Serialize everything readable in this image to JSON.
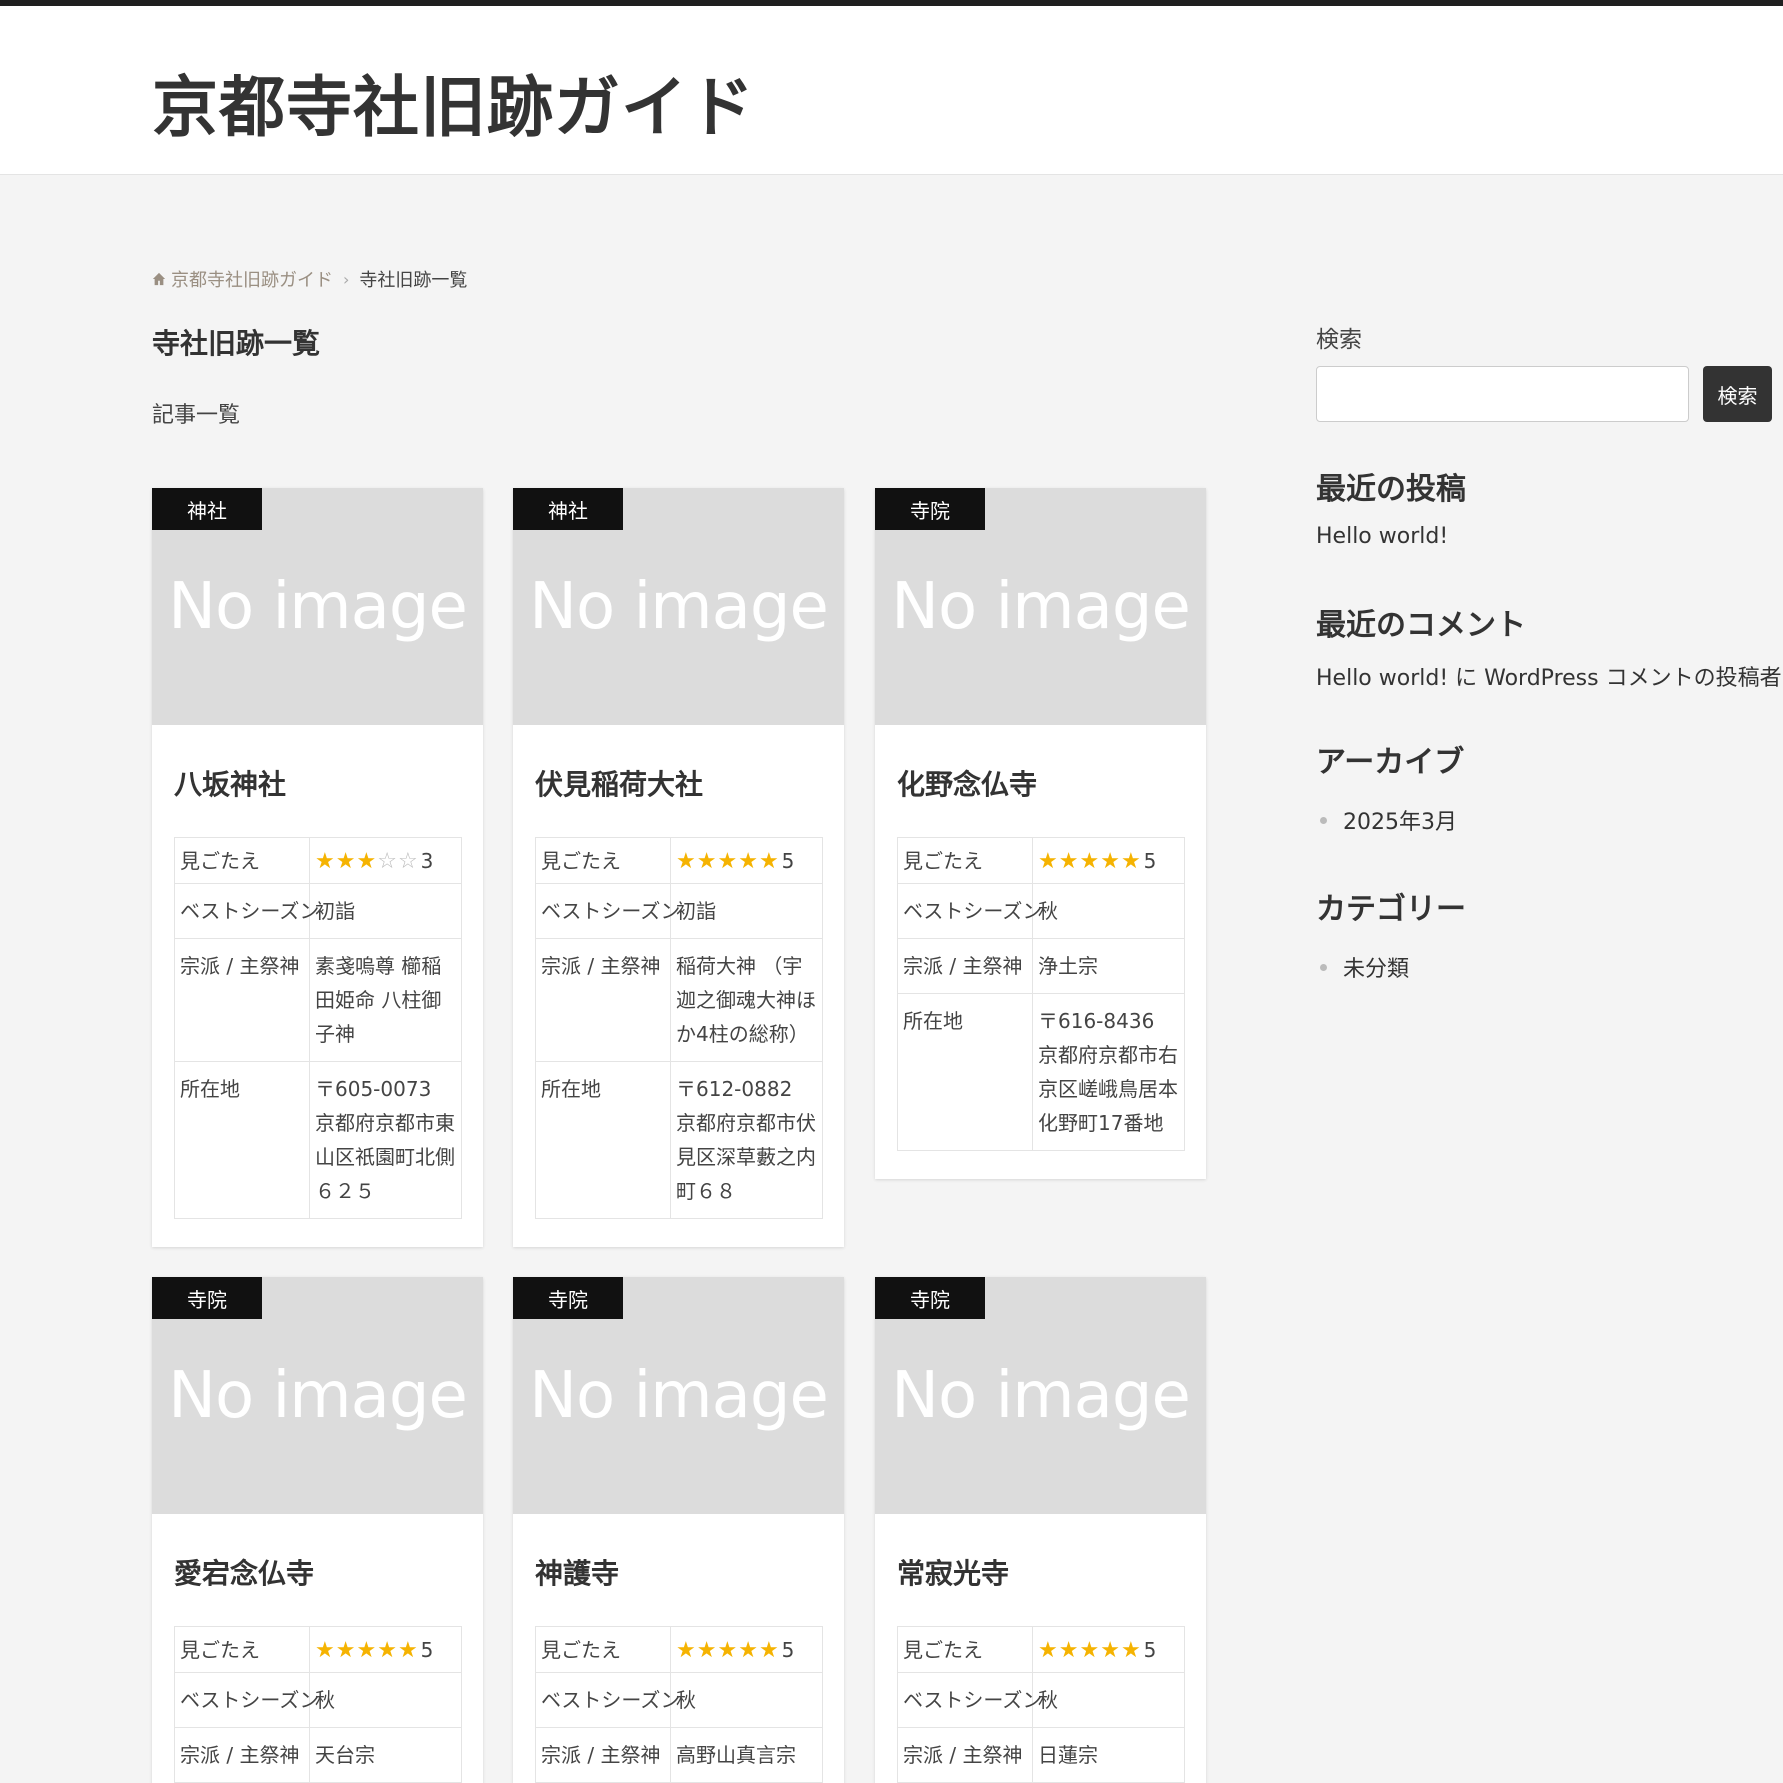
{
  "site": {
    "title": "京都寺社旧跡ガイド"
  },
  "breadcrumb": {
    "home": "京都寺社旧跡ガイド",
    "separator": "›",
    "current": "寺社旧跡一覧"
  },
  "page": {
    "title": "寺社旧跡一覧",
    "subtitle": "記事一覧"
  },
  "labels": {
    "no_image": "No image",
    "rating": "見ごたえ",
    "season": "ベストシーズン",
    "sect": "宗派 / 主祭神",
    "address": "所在地"
  },
  "cards": [
    {
      "category": "神社",
      "title": "八坂神社",
      "rating": 3,
      "rating_label": "3",
      "season": "初詣",
      "sect": "素戔嗚尊 櫛稲田姫命 八柱御子神",
      "address": "〒605-0073 京都府京都市東山区祇園町北側６２５"
    },
    {
      "category": "神社",
      "title": "伏見稲荷大社",
      "rating": 5,
      "rating_label": "5",
      "season": "初詣",
      "sect": "稲荷大神 （宇迦之御魂大神ほか4柱の総称）",
      "address": "〒612-0882 京都府京都市伏見区深草藪之内町６８"
    },
    {
      "category": "寺院",
      "title": "化野念仏寺",
      "rating": 5,
      "rating_label": "5",
      "season": "秋",
      "sect": "浄土宗",
      "address": "〒616-8436 京都府京都市右京区嵯峨鳥居本化野町17番地"
    },
    {
      "category": "寺院",
      "title": "愛宕念仏寺",
      "rating": 5,
      "rating_label": "5",
      "season": "秋",
      "sect": "天台宗",
      "address": ""
    },
    {
      "category": "寺院",
      "title": "神護寺",
      "rating": 5,
      "rating_label": "5",
      "season": "秋",
      "sect": "高野山真言宗",
      "address": ""
    },
    {
      "category": "寺院",
      "title": "常寂光寺",
      "rating": 5,
      "rating_label": "5",
      "season": "秋",
      "sect": "日蓮宗",
      "address": ""
    }
  ],
  "sidebar": {
    "search": {
      "label": "検索",
      "placeholder": "",
      "button": "検索"
    },
    "recent_posts": {
      "title": "最近の投稿",
      "items": [
        "Hello world!"
      ]
    },
    "recent_comments": {
      "title": "最近のコメント",
      "items": [
        "Hello world! に WordPress コメントの投稿者 より"
      ]
    },
    "archives": {
      "title": "アーカイブ",
      "items": [
        "2025年3月"
      ]
    },
    "categories": {
      "title": "カテゴリー",
      "items": [
        "未分類"
      ]
    }
  },
  "colors": {
    "accent_star": "#f5b301",
    "header_bar": "#1f1f1f",
    "badge_bg": "#111111",
    "button_bg": "#333333"
  }
}
